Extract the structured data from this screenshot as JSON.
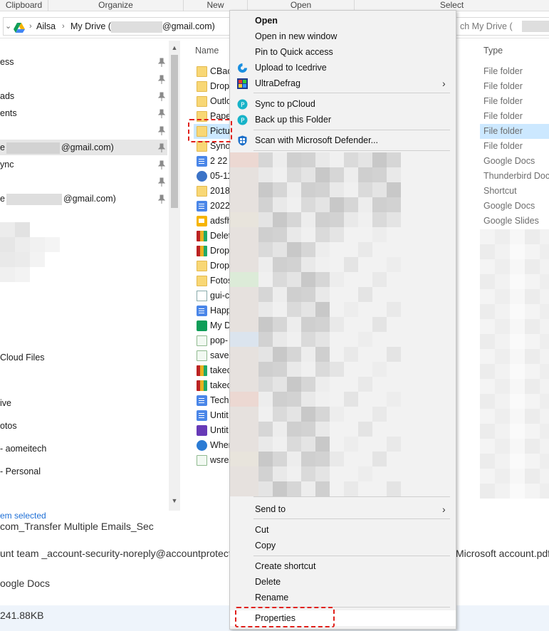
{
  "ribbon": {
    "groups": [
      "Clipboard",
      "Organize",
      "New",
      "Open",
      "Select"
    ]
  },
  "address": {
    "root_icon": "google-drive-icon",
    "crumb_1": "Ailsa",
    "crumb_2_prefix": "My Drive (",
    "crumb_2_suffix": "@gmail.com)",
    "search_placeholder": "ch My Drive ("
  },
  "nav": {
    "items": [
      {
        "label": "ess",
        "pinned": true
      },
      {
        "label": "ads",
        "pinned": true
      },
      {
        "label": "ents",
        "pinned": true
      },
      {
        "label": "",
        "pinned": true
      },
      {
        "label_prefix": "e",
        "label_suffix": "@gmail.com)",
        "pinned": true,
        "selected": true
      },
      {
        "label": "ync",
        "pinned": true
      },
      {
        "label": "",
        "pinned": true
      },
      {
        "label_prefix": "e",
        "label_suffix": "@gmail.com)",
        "pinned": true
      },
      {
        "label": "Cloud Files"
      },
      {
        "label": "ive"
      },
      {
        "label": "otos"
      },
      {
        "label": "- aomeitech"
      },
      {
        "label": "- Personal"
      }
    ],
    "status": "em selected"
  },
  "files": {
    "col_name": "Name",
    "col_type": "Type",
    "rows": [
      {
        "name": "CBac",
        "icon": "folder-icon",
        "type": "File folder"
      },
      {
        "name": "Dropl",
        "icon": "folder-icon",
        "type": "File folder"
      },
      {
        "name": "Outlo",
        "icon": "folder-icon",
        "type": "File folder"
      },
      {
        "name": "Pape",
        "icon": "folder-icon",
        "type": "File folder"
      },
      {
        "name": "Pictu",
        "icon": "folder-icon",
        "type": "File folder",
        "selected": true
      },
      {
        "name": "Synol",
        "icon": "folder-icon",
        "type": "File folder"
      },
      {
        "name": "2 22 c",
        "icon": "google-docs-icon",
        "type": "Google Docs"
      },
      {
        "name": "05-11",
        "icon": "thunderbird-icon",
        "type": "Thunderbird Docu"
      },
      {
        "name": "2018C",
        "icon": "shortcut-icon",
        "type": "Shortcut"
      },
      {
        "name": "2022.",
        "icon": "google-docs-icon",
        "type": "Google Docs"
      },
      {
        "name": "adsfh",
        "icon": "google-slides-icon",
        "type": "Google Slides"
      },
      {
        "name": "Delet",
        "icon": "winrar-icon",
        "type": ""
      },
      {
        "name": "Drop",
        "icon": "winrar-icon",
        "type": ""
      },
      {
        "name": "Drop",
        "icon": "shortcut-icon",
        "type": ""
      },
      {
        "name": "Fotos",
        "icon": "shortcut-icon",
        "type": ""
      },
      {
        "name": "gui-c",
        "icon": "text-file-icon",
        "type": ""
      },
      {
        "name": "Happ",
        "icon": "google-docs-icon",
        "type": ""
      },
      {
        "name": "My D",
        "icon": "google-sheets-icon",
        "type": ""
      },
      {
        "name": "pop-",
        "icon": "png-file-icon",
        "type": ""
      },
      {
        "name": "save-",
        "icon": "png-file-icon",
        "type": ""
      },
      {
        "name": "takec",
        "icon": "winrar-icon",
        "type": ""
      },
      {
        "name": "takec",
        "icon": "winrar-icon",
        "type": ""
      },
      {
        "name": "Techr",
        "icon": "google-docs-icon",
        "type": ""
      },
      {
        "name": "Untit",
        "icon": "google-docs-icon",
        "type": ""
      },
      {
        "name": "Untit",
        "icon": "google-forms-icon",
        "type": ""
      },
      {
        "name": "When",
        "icon": "edge-shortcut-icon",
        "type": ""
      },
      {
        "name": "wsres",
        "icon": "png-file-icon",
        "type": ""
      }
    ]
  },
  "background": {
    "line_1": "com_Transfer Multiple Emails_Sec",
    "line_2_left": "unt team _account-security-noreply@accountprotect",
    "line_2_right": "Microsoft account.pdf",
    "line_3": "oogle Docs",
    "line_4": "241.88KB"
  },
  "menu": {
    "items": [
      {
        "label": "Open",
        "bold": true
      },
      {
        "label": "Open in new window"
      },
      {
        "label": "Pin to Quick access"
      },
      {
        "label": "Upload to Icedrive",
        "icon": "icedrive-icon"
      },
      {
        "label": "UltraDefrag",
        "icon": "ultradefrag-icon",
        "submenu": true
      },
      {
        "label": "Sync to pCloud",
        "icon": "pcloud-icon"
      },
      {
        "label": "Back up this Folder",
        "icon": "pcloud-icon"
      },
      {
        "label": "Scan with Microsoft Defender...",
        "icon": "defender-icon"
      },
      {
        "label": "Send to",
        "submenu": true
      },
      {
        "label": "Cut"
      },
      {
        "label": "Copy"
      },
      {
        "label": "Create shortcut"
      },
      {
        "label": "Delete"
      },
      {
        "label": "Rename"
      },
      {
        "label": "Properties"
      }
    ]
  },
  "colors": {
    "accent_selection": "#cce8ff",
    "highlight_dash": "#e0201a",
    "menu_bg": "#f2f2f2"
  }
}
